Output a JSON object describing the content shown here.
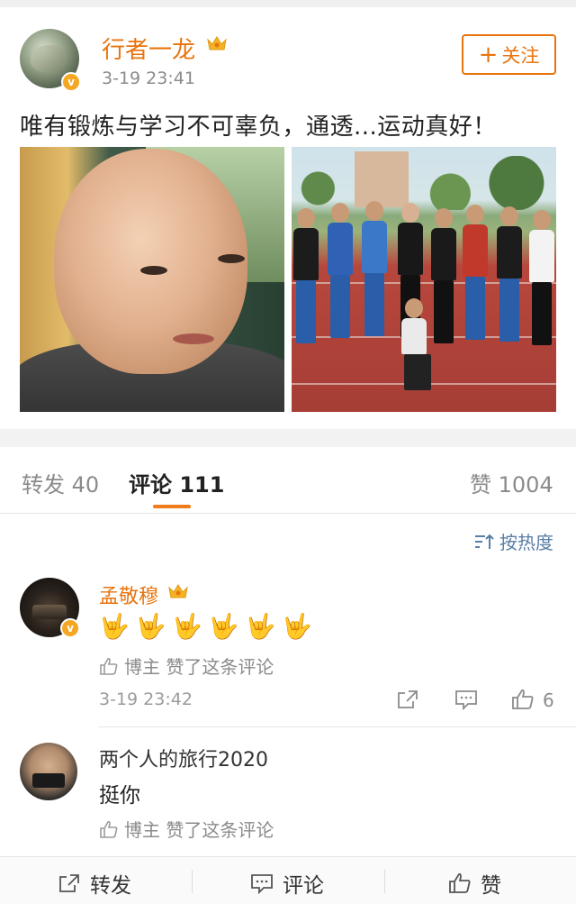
{
  "post": {
    "author": "行者一龙",
    "time": "3-19 23:41",
    "follow_label": "关注",
    "text": "唯有锻炼与学习不可辜负，通透...运动真好！",
    "verified_mark": "v"
  },
  "tabs": {
    "repost_label": "转发",
    "repost_count": "40",
    "comment_label": "评论",
    "comment_count": "111",
    "likes_label": "赞",
    "likes_count": "1004"
  },
  "sort_label": "按热度",
  "comments": [
    {
      "author": "孟敬穆",
      "content": "🤟🤟🤟🤟🤟🤟",
      "liked_by_author": "博主 赞了这条评论",
      "time": "3-19 23:42",
      "likes": "6"
    },
    {
      "author": "两个人的旅行2020",
      "content": "挺你",
      "liked_by_author": "博主 赞了这条评论"
    }
  ],
  "bottom_bar": {
    "repost": "转发",
    "comment": "评论",
    "like": "赞"
  },
  "colors": {
    "accent": "#e8740e",
    "link": "#5b7ea5"
  }
}
